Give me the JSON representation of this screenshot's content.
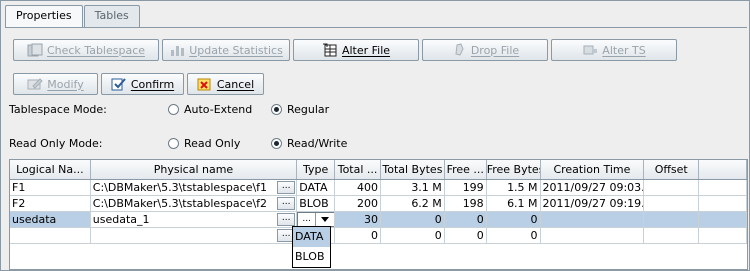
{
  "tabs": [
    {
      "label": "Properties"
    },
    {
      "label": "Tables"
    }
  ],
  "toolbar": {
    "check_tablespace": "Check Tablespace",
    "update_statistics": "Update Statistics",
    "alter_file": "Alter File",
    "drop_file": "Drop File",
    "alter_ts": "Alter TS",
    "modify": "Modify",
    "confirm": "Confirm",
    "cancel": "Cancel"
  },
  "tablespace_mode": {
    "label": "Tablespace Mode:",
    "options": [
      "Auto-Extend",
      "Regular"
    ],
    "selected": "Regular"
  },
  "read_only_mode": {
    "label": "Read Only Mode:",
    "options": [
      "Read Only",
      "Read/Write"
    ],
    "selected": "Read/Write"
  },
  "table": {
    "columns": [
      "Logical Na...",
      "Physical name",
      "Type",
      "Total ...",
      "Total Bytes",
      "Free ...",
      "Free Bytes",
      "Creation Time",
      "Offset"
    ],
    "rows": [
      [
        "F1",
        "C:\\DBMaker\\5.3\\tstablespace\\f1",
        "DATA",
        "400",
        "3.1 M",
        "199",
        "1.5 M",
        "2011/09/27 09:03...",
        ""
      ],
      [
        "F2",
        "C:\\DBMaker\\5.3\\tstablespace\\f2",
        "BLOB",
        "200",
        "6.2 M",
        "198",
        "6.1 M",
        "2011/09/27 09:19...",
        ""
      ],
      [
        "usedata",
        "usedata_1",
        "",
        "30",
        "0",
        "0",
        "0",
        "",
        ""
      ],
      [
        "",
        "",
        "",
        "0",
        "0",
        "0",
        "0",
        "",
        ""
      ]
    ],
    "ellipsis": "...",
    "type_dropdown": [
      "DATA",
      "BLOB"
    ]
  }
}
